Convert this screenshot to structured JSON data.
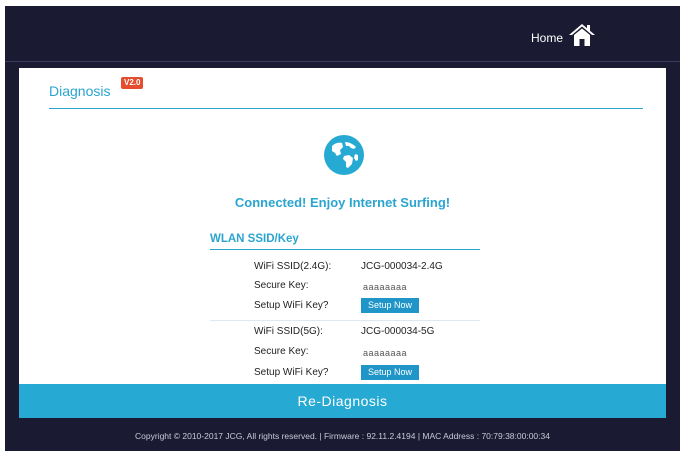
{
  "header": {
    "home_label": "Home",
    "home_icon": "home-icon"
  },
  "page": {
    "title": "Diagnosis",
    "version_badge": "V2.0",
    "status_icon": "globe-icon",
    "status_message": "Connected! Enjoy Internet Surfing!"
  },
  "wlan": {
    "section_title": "WLAN SSID/Key",
    "bands": [
      {
        "ssid_label": "WiFi SSID(2.4G):",
        "ssid_value": "JCG-000034-2.4G",
        "key_label": "Secure Key:",
        "key_value": "aaaaaaaa",
        "setup_label": "Setup WiFi Key?",
        "setup_button": "Setup Now"
      },
      {
        "ssid_label": "WiFi SSID(5G):",
        "ssid_value": "JCG-000034-5G",
        "key_label": "Secure Key:",
        "key_value": "aaaaaaaa",
        "setup_label": "Setup WiFi Key?",
        "setup_button": "Setup Now"
      }
    ]
  },
  "actions": {
    "rediagnosis": "Re-Diagnosis"
  },
  "footer": {
    "text": "Copyright © 2010-2017 JCG, All rights reserved.  |  Firmware : 92.11.2.4194  |  MAC Address : 70:79:38:00:00:34"
  },
  "colors": {
    "frame_bg": "#1b1a33",
    "accent": "#2aa5cf",
    "button": "#1f95c8",
    "badge": "#e44d2e"
  }
}
